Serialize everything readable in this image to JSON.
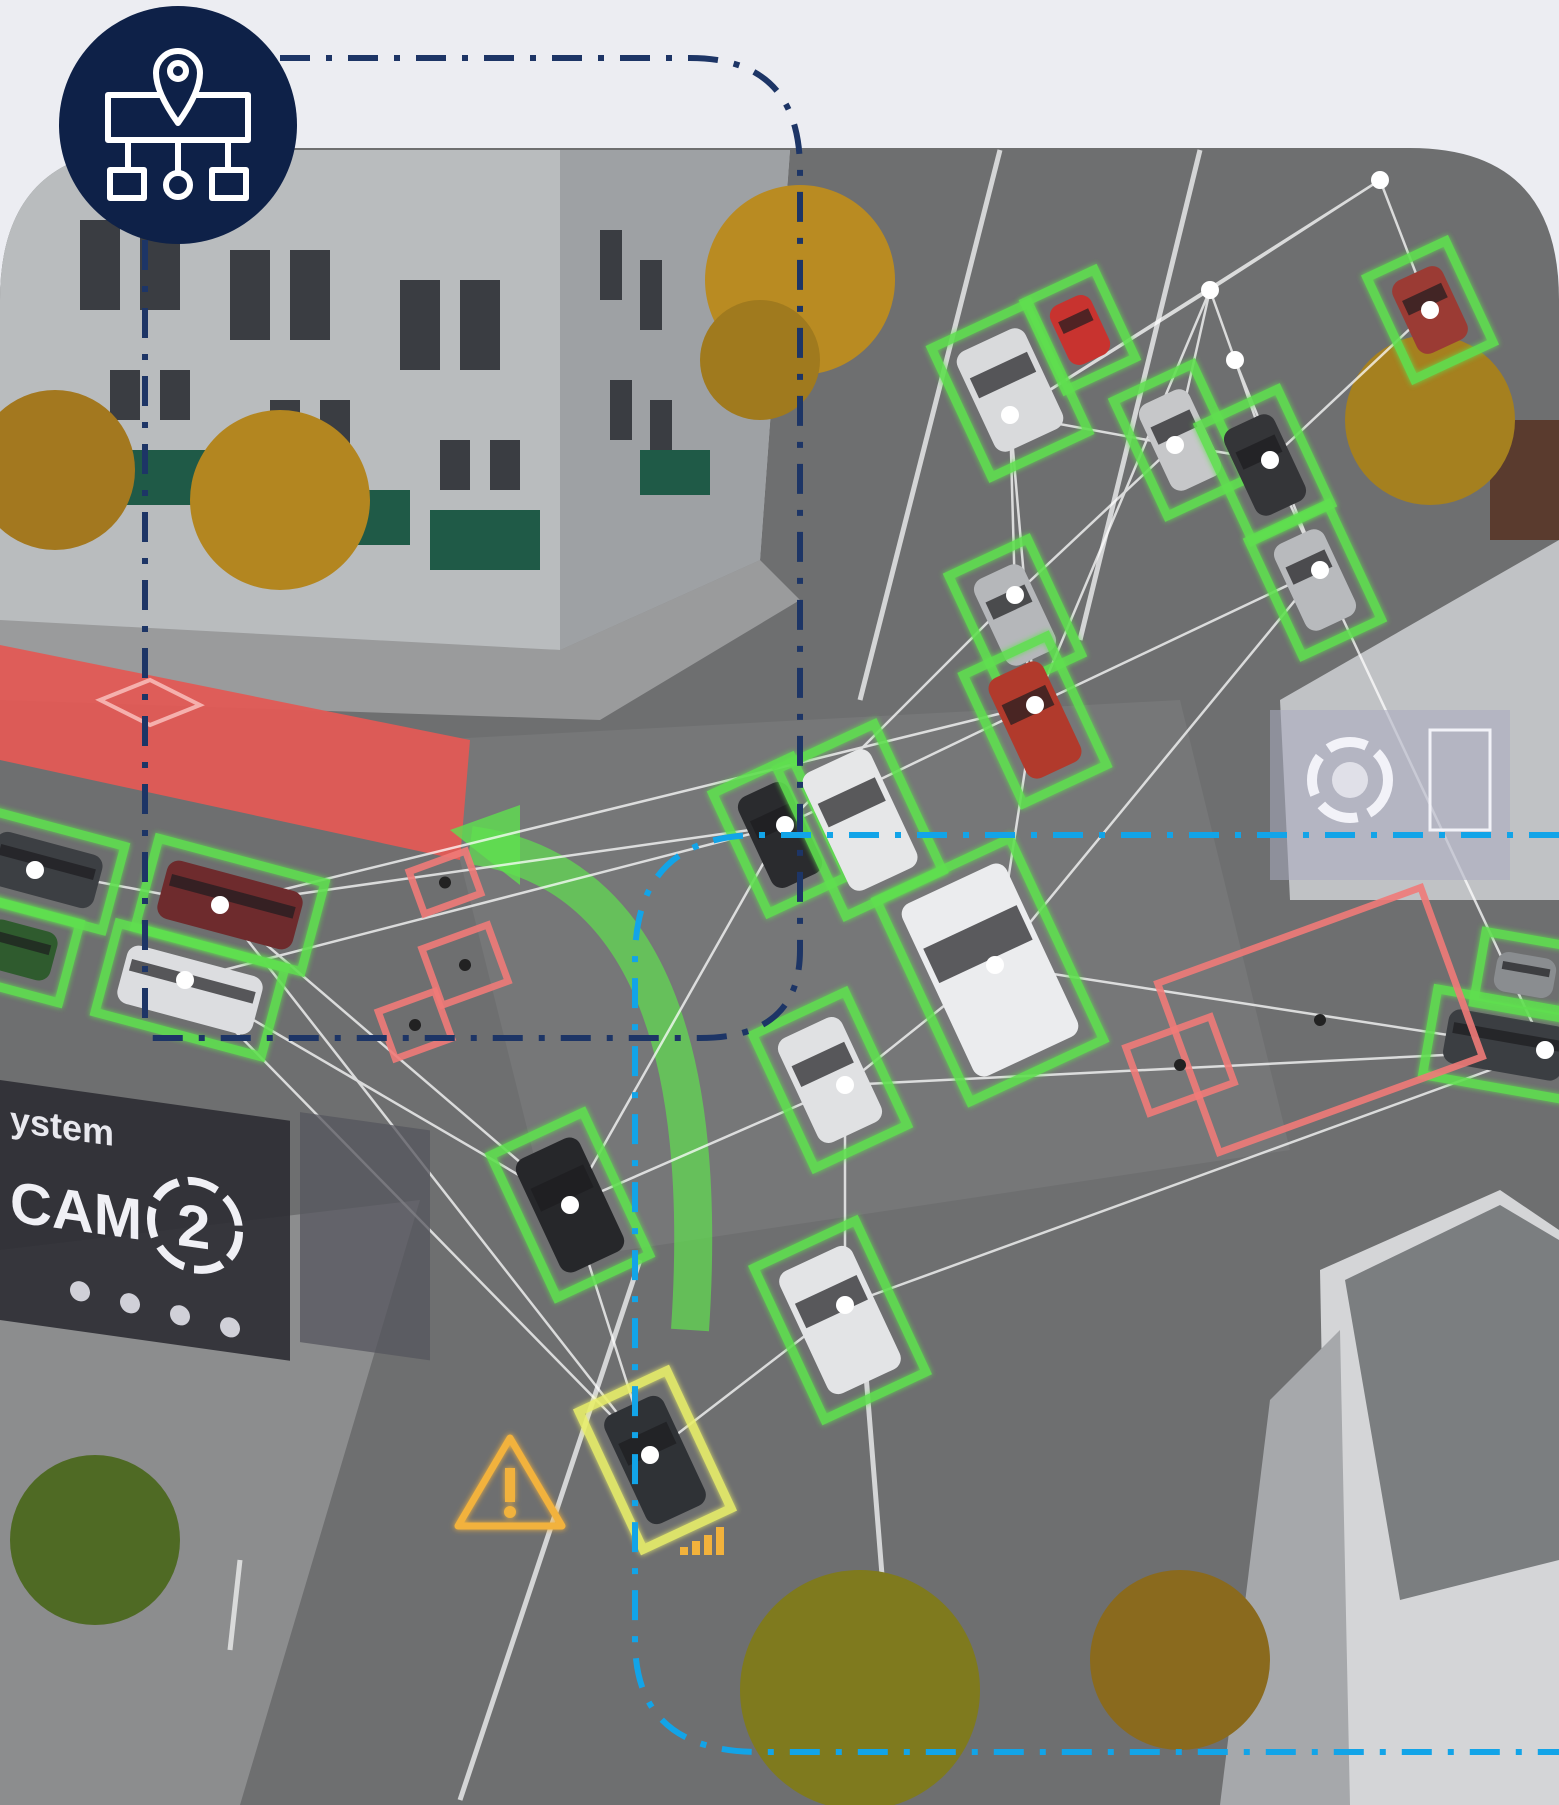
{
  "colors": {
    "page_background": "#ecedf2",
    "road": "#6e6f70",
    "building": "#b9bcbe",
    "bus_lane": "#e25a55",
    "detection_box": "#5fe04f",
    "pedestrian_box": "#f07a78",
    "warning_box": "#e9ef6a",
    "network_line": "#ffffff",
    "badge": "#0e2148",
    "outline_dark_blue": "#1d3566",
    "outline_light_blue": "#12a4e8",
    "warning_icon": "#f2b23c"
  },
  "badge": {
    "icon": "location-network-icon"
  },
  "overlays": {
    "camera_panel": {
      "system_text": "ystem",
      "cam_text": "CAM",
      "cam_number": "2"
    },
    "warning": {
      "icon": "warning-triangle-icon",
      "signal_icon": "signal-bars-icon"
    },
    "hud_icon": "gear-ring-icon"
  },
  "detections": {
    "vehicles_detected": 21,
    "pedestrian_zones": 5,
    "hazard_vehicles": 1
  }
}
